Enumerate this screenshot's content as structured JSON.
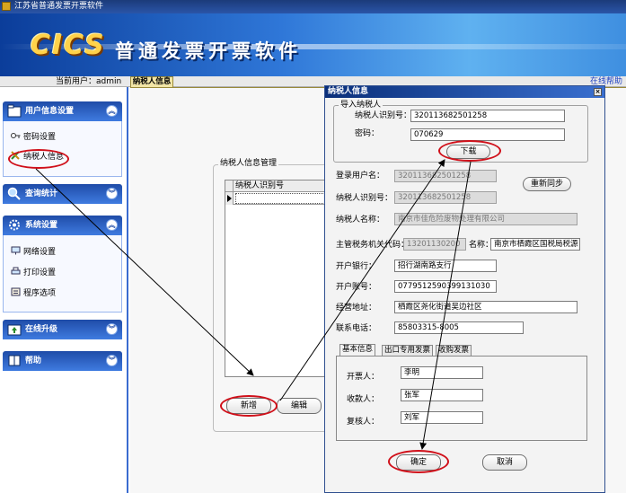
{
  "app": {
    "window_title": "江苏省普通发票开票软件",
    "logo_text": "CICS",
    "banner_title": "普通发票开票软件"
  },
  "statusbar": {
    "current_user": "当前用户：admin",
    "help_link": "在线帮助"
  },
  "main_tab": {
    "label": "纳税人信息"
  },
  "sidebar": {
    "sections": [
      {
        "label": "用户信息设置",
        "items": [
          "密码设置",
          "纳税人信息"
        ]
      },
      {
        "label": "查询统计",
        "items": []
      },
      {
        "label": "系统设置",
        "items": [
          "网络设置",
          "打印设置",
          "程序选项"
        ]
      },
      {
        "label": "在线升级",
        "items": []
      },
      {
        "label": "帮助",
        "items": []
      }
    ]
  },
  "taxpayer_manager": {
    "group_title": "纳税人信息管理",
    "grid_column": "纳税人识别号",
    "add_button": "新增",
    "edit_button": "编辑"
  },
  "dialog": {
    "title": "纳税人信息",
    "close": "×",
    "import_group": {
      "legend": "导入纳税人",
      "taxpayer_id_label": "纳税人识别号：",
      "taxpayer_id_value": "320113682501258",
      "password_label": "密码：",
      "password_value": "070629",
      "download_button": "下载"
    },
    "login_user_label": "登录用户名：",
    "login_user_value": "320113682501258",
    "resync_button": "重新同步",
    "taxpayer_id_label": "纳税人识别号：",
    "taxpayer_id_value": "320113682501258",
    "taxpayer_name_label": "纳税人名称：",
    "taxpayer_name_value": "南京市佳危险废物处理有限公司",
    "tax_office_code_label": "主管税务机关代码：",
    "tax_office_code_value": "13201130200",
    "tax_office_name_label": "名称：",
    "tax_office_name_value": "南京市栖霞区国税局税源",
    "bank_label": "开户银行：",
    "bank_value": "招行湖南路支行",
    "account_label": "开户账号：",
    "account_value": "0779512590399131030",
    "address_label": "经营地址：",
    "address_value": "栖霞区尧化街道吴边社区",
    "phone_label": "联系电话：",
    "phone_value": "85803315-8005",
    "tabs": [
      "基本信息",
      "出口专用发票",
      "收购发票"
    ],
    "drawer_label": "开票人：",
    "drawer_value": "李明",
    "payee_label": "收款人：",
    "payee_value": "张军",
    "reviewer_label": "复核人：",
    "reviewer_value": "刘军",
    "ok_button": "确定",
    "cancel_button": "取消"
  },
  "colors": {
    "titlebar": "#1b3b7a",
    "sidebar_header": "#1f4ca8",
    "annotation_red": "#d0101a",
    "link_blue": "#1c3fc2",
    "tab_active": "#f2e5a6"
  }
}
